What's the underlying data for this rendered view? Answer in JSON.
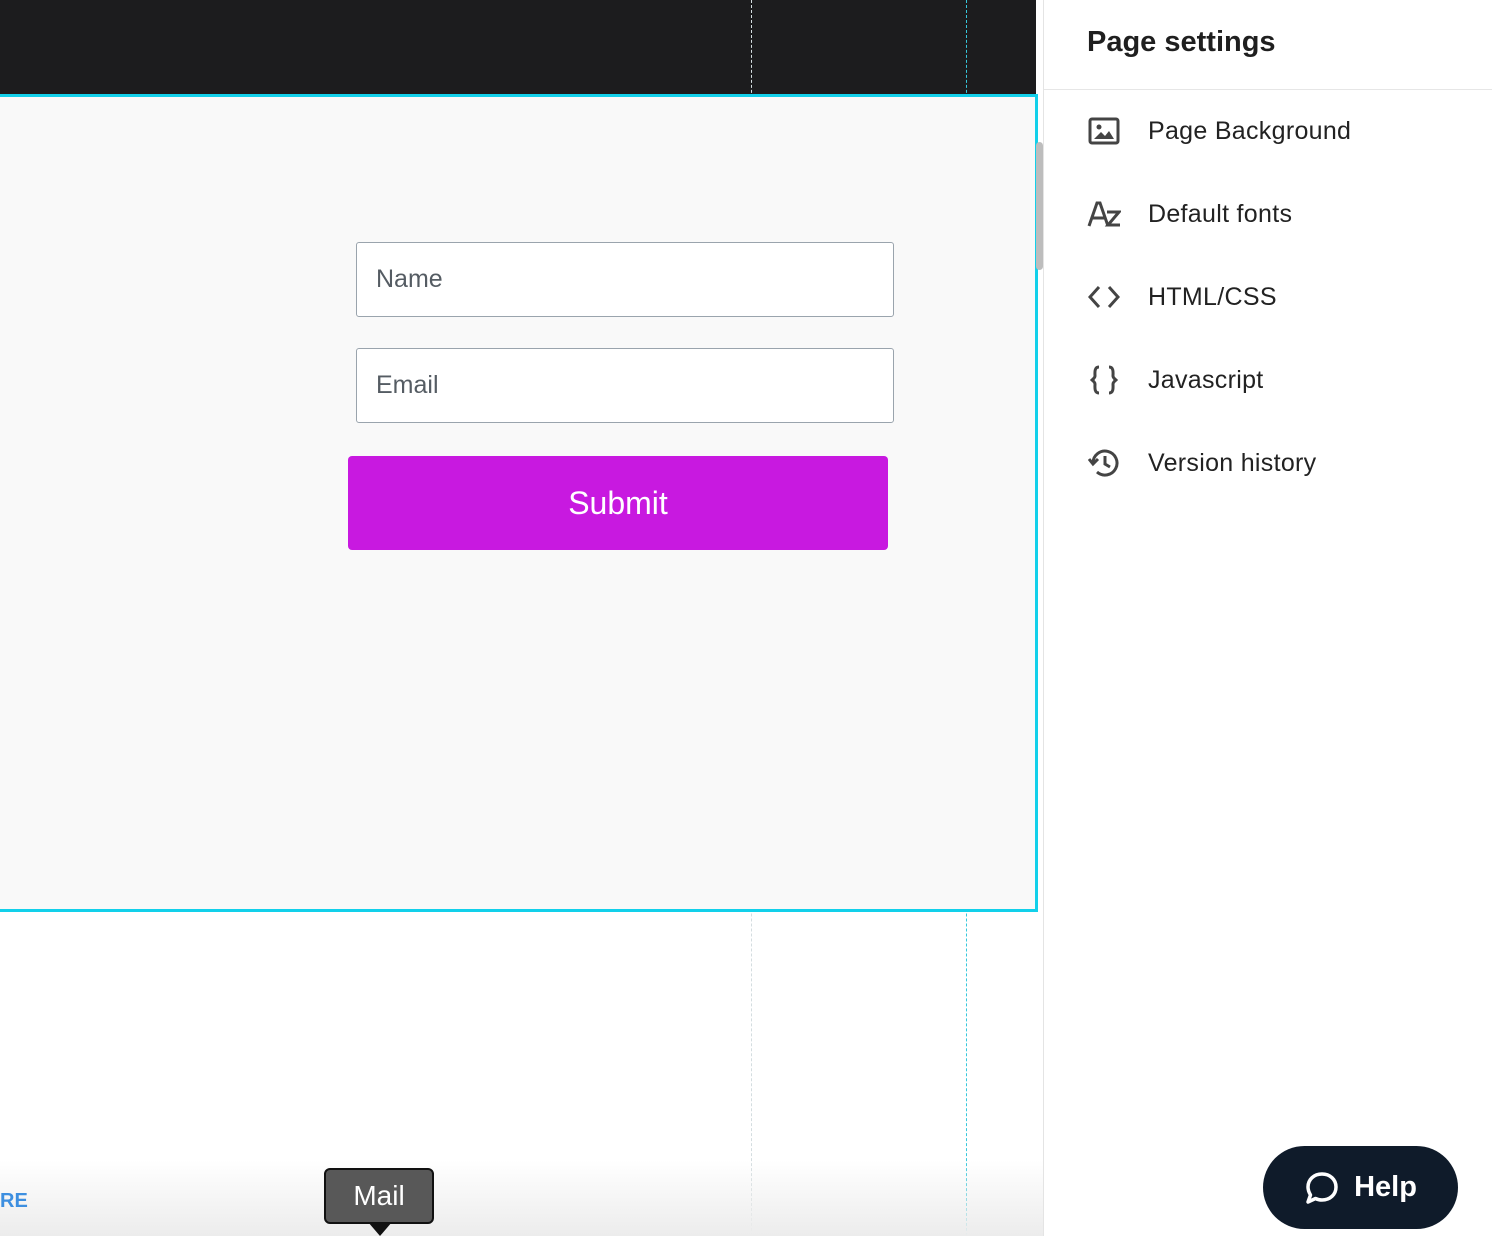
{
  "canvas": {
    "form": {
      "name_placeholder": "Name",
      "email_placeholder": "Email",
      "submit_label": "Submit"
    },
    "partial_link_text": "RE",
    "tooltip_text": "Mail",
    "colors": {
      "topbar": "#1c1c1e",
      "selection_outline": "#12d0ea",
      "submit_bg": "#c819e0"
    }
  },
  "settings_panel": {
    "title": "Page settings",
    "items": [
      {
        "label": "Page Background",
        "icon": "image-icon"
      },
      {
        "label": "Default fonts",
        "icon": "font-az-icon"
      },
      {
        "label": "HTML/CSS",
        "icon": "code-icon"
      },
      {
        "label": "Javascript",
        "icon": "curly-braces-icon"
      },
      {
        "label": "Version history",
        "icon": "history-icon"
      }
    ]
  },
  "help_button": {
    "label": "Help",
    "icon": "chat-bubble-icon"
  }
}
